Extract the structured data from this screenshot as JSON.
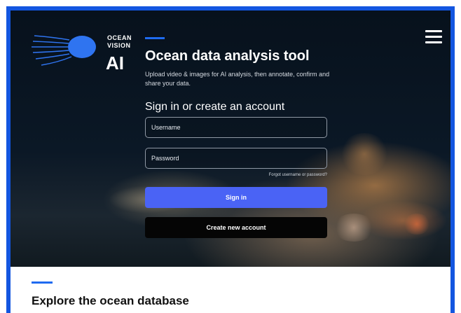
{
  "colors": {
    "frame": "#1356e0",
    "accent": "#1f6bf0",
    "signin_button": "#4a63f5",
    "create_button": "#050505"
  },
  "logo": {
    "line1": "OCEAN",
    "line2": "VISION",
    "line3": "AI",
    "icon": "jellyfish-icon"
  },
  "menu": {
    "icon": "hamburger-menu-icon"
  },
  "hero": {
    "title": "Ocean data analysis tool",
    "subtitle": "Upload video & images for AI analysis, then annotate, confirm and share your data."
  },
  "signin": {
    "heading": "Sign in or create an account",
    "username_placeholder": "Username",
    "username_value": "",
    "password_placeholder": "Password",
    "password_value": "",
    "forgot_link": "Forgot username or password?",
    "signin_button": "Sign in",
    "create_button": "Create new account"
  },
  "explore": {
    "title": "Explore the ocean database"
  }
}
